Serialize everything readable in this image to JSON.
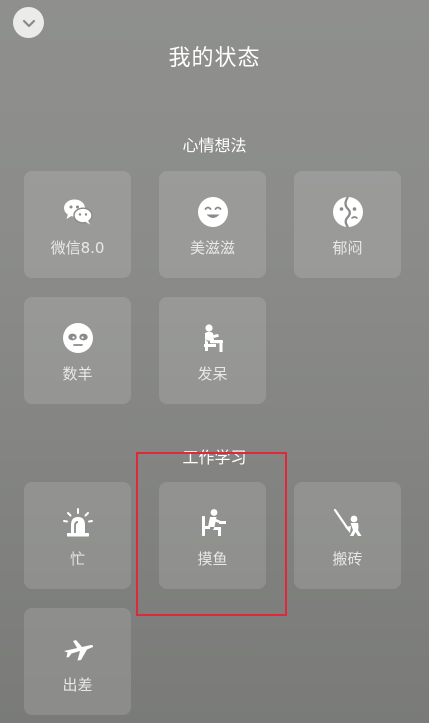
{
  "header": {
    "title": "我的状态",
    "collapse_icon": "chevron-down-icon"
  },
  "sections": [
    {
      "title": "心情想法",
      "items": [
        {
          "label": "微信8.0",
          "icon": "wechat-icon"
        },
        {
          "label": "美滋滋",
          "icon": "smiley-icon"
        },
        {
          "label": "郁闷",
          "icon": "gloomy-icon"
        },
        {
          "label": "数羊",
          "icon": "sheep-icon"
        },
        {
          "label": "发呆",
          "icon": "daze-icon"
        }
      ]
    },
    {
      "title": "工作学习",
      "items": [
        {
          "label": "忙",
          "icon": "siren-icon"
        },
        {
          "label": "摸鱼",
          "icon": "slacking-icon"
        },
        {
          "label": "搬砖",
          "icon": "shovel-worker-icon"
        },
        {
          "label": "出差",
          "icon": "airplane-icon"
        }
      ]
    }
  ],
  "colors": {
    "highlight": "#e0283a",
    "background": "#8b8c89"
  }
}
